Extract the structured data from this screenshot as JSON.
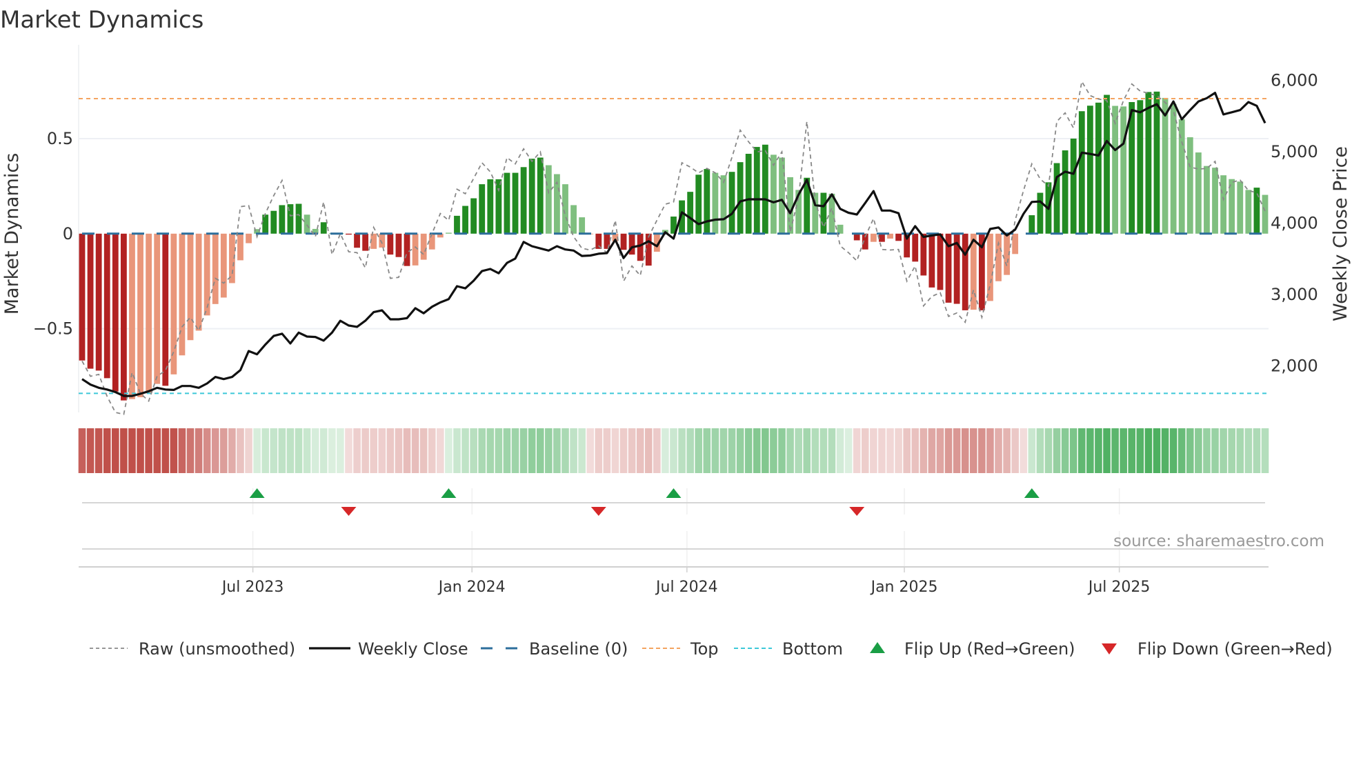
{
  "chart_data": {
    "type": "bar",
    "title": "Market Dynamics",
    "ylabel": "Market Dynamics",
    "y2label": "Weekly Close Price",
    "ylim": [
      -0.94,
      0.935
    ],
    "y2lim": [
      1345,
      6345
    ],
    "y_ticks": [
      {
        "v": 0.5,
        "label": "0.5"
      },
      {
        "v": 0,
        "label": "0"
      },
      {
        "v": -0.5,
        "label": "−0.5"
      }
    ],
    "y2_ticks": [
      {
        "v": 6000,
        "label": "6,000"
      },
      {
        "v": 5000,
        "label": "5,000"
      },
      {
        "v": 4000,
        "label": "4,000"
      },
      {
        "v": 3000,
        "label": "3,000"
      },
      {
        "v": 2000,
        "label": "2,000"
      }
    ],
    "x_unit": "week index",
    "x_ticks": [
      {
        "v": 20.5,
        "label": "Jul 2023"
      },
      {
        "v": 46.8,
        "label": "Jan 2024"
      },
      {
        "v": 72.6,
        "label": "Jul 2024"
      },
      {
        "v": 98.7,
        "label": "Jan 2025"
      },
      {
        "v": 124.5,
        "label": "Jul 2025"
      }
    ],
    "top_level": 0.71,
    "bottom_level": -0.84,
    "baseline": 0,
    "grid": true,
    "legend_position": "bottom",
    "smoothed": [
      -0.667,
      -0.71,
      -0.72,
      -0.76,
      -0.83,
      -0.877,
      -0.87,
      -0.86,
      -0.84,
      -0.79,
      -0.8,
      -0.74,
      -0.64,
      -0.56,
      -0.51,
      -0.43,
      -0.37,
      -0.336,
      -0.26,
      -0.14,
      -0.05,
      0.024,
      0.1,
      0.12,
      0.15,
      0.155,
      0.157,
      0.1,
      0.025,
      0.06,
      0.003,
      0.003,
      -0.005,
      -0.074,
      -0.09,
      -0.08,
      -0.073,
      -0.11,
      -0.123,
      -0.17,
      -0.167,
      -0.137,
      -0.083,
      -0.02,
      0.005,
      0.094,
      0.146,
      0.186,
      0.26,
      0.286,
      0.286,
      0.32,
      0.32,
      0.35,
      0.394,
      0.4,
      0.36,
      0.313,
      0.26,
      0.15,
      0.086,
      -0.003,
      -0.08,
      -0.08,
      -0.04,
      -0.085,
      -0.11,
      -0.143,
      -0.168,
      -0.095,
      0.02,
      0.09,
      0.175,
      0.22,
      0.31,
      0.34,
      0.32,
      0.307,
      0.325,
      0.376,
      0.42,
      0.456,
      0.468,
      0.415,
      0.4,
      0.297,
      0.23,
      0.294,
      0.215,
      0.215,
      0.21,
      0.047,
      0.0,
      -0.035,
      -0.083,
      -0.043,
      -0.043,
      -0.026,
      -0.038,
      -0.125,
      -0.147,
      -0.22,
      -0.283,
      -0.296,
      -0.363,
      -0.369,
      -0.403,
      -0.4,
      -0.403,
      -0.354,
      -0.25,
      -0.217,
      -0.107,
      0.0,
      0.097,
      0.215,
      0.27,
      0.371,
      0.438,
      0.5,
      0.644,
      0.673,
      0.689,
      0.73,
      0.672,
      0.669,
      0.692,
      0.702,
      0.745,
      0.747,
      0.714,
      0.682,
      0.602,
      0.507,
      0.427,
      0.356,
      0.347,
      0.307,
      0.287,
      0.274,
      0.23,
      0.242,
      0.204
    ],
    "raw": [
      -0.67,
      -0.75,
      -0.74,
      -0.855,
      -0.94,
      -0.95,
      -0.73,
      -0.84,
      -0.88,
      -0.75,
      -0.72,
      -0.62,
      -0.49,
      -0.44,
      -0.51,
      -0.39,
      -0.235,
      -0.26,
      -0.22,
      0.142,
      0.148,
      -0.016,
      0.106,
      0.2,
      0.28,
      0.094,
      0.1,
      0.045,
      -0.016,
      0.167,
      -0.11,
      0,
      -0.095,
      -0.1,
      -0.18,
      0.033,
      -0.05,
      -0.235,
      -0.23,
      -0.1,
      -0.07,
      -0.11,
      0,
      0.106,
      0.07,
      0.234,
      0.21,
      0.29,
      0.373,
      0.325,
      0.228,
      0.4,
      0.367,
      0.446,
      0.38,
      0.43,
      0.215,
      0.27,
      0.094,
      -0.016,
      -0.077,
      -0.086,
      -0.064,
      -0.1,
      0.07,
      -0.25,
      -0.17,
      -0.22,
      -0.016,
      0.07,
      0.155,
      0.167,
      0.373,
      0.35,
      0.32,
      0.343,
      0.32,
      0.27,
      0.4,
      0.544,
      0.483,
      0.43,
      0.437,
      0.36,
      0.43,
      0.01,
      0.19,
      0.59,
      0.167,
      0.033,
      0.136,
      -0.064,
      -0.1,
      -0.143,
      -0.016,
      0.08,
      -0.083,
      -0.086,
      -0.083,
      -0.25,
      -0.17,
      -0.38,
      -0.33,
      -0.31,
      -0.435,
      -0.417,
      -0.466,
      -0.296,
      -0.44,
      -0.27,
      -0.05,
      -0.17,
      0.07,
      0.227,
      0.367,
      0.288,
      0.25,
      0.59,
      0.635,
      0.556,
      0.8,
      0.726,
      0.708,
      0.7,
      0.58,
      0.7,
      0.787,
      0.75,
      0.738,
      0.726,
      0.69,
      0.647,
      0.483,
      0.35,
      0.34,
      0.343,
      0.38,
      0.18,
      0.27,
      0.282,
      0.227,
      0.215,
      0.118
    ],
    "weekly_close": [
      1812,
      1736,
      1690,
      1666,
      1630,
      1576,
      1576,
      1606,
      1642,
      1690,
      1666,
      1660,
      1715,
      1715,
      1690,
      1751,
      1842,
      1812,
      1842,
      1939,
      2206,
      2160,
      2297,
      2418,
      2448,
      2312,
      2464,
      2409,
      2403,
      2352,
      2464,
      2630,
      2564,
      2545,
      2630,
      2751,
      2776,
      2651,
      2651,
      2667,
      2806,
      2736,
      2827,
      2888,
      2933,
      3115,
      3085,
      3191,
      3327,
      3357,
      3297,
      3442,
      3503,
      3736,
      3676,
      3645,
      3615,
      3676,
      3630,
      3615,
      3539,
      3545,
      3570,
      3579,
      3767,
      3509,
      3660,
      3685,
      3745,
      3676,
      3872,
      3782,
      4151,
      4070,
      3985,
      4024,
      4048,
      4054,
      4130,
      4303,
      4333,
      4333,
      4333,
      4291,
      4327,
      4139,
      4400,
      4606,
      4251,
      4236,
      4403,
      4200,
      4145,
      4121,
      4282,
      4448,
      4176,
      4176,
      4139,
      3782,
      3957,
      3806,
      3827,
      3842,
      3676,
      3721,
      3557,
      3767,
      3661,
      3918,
      3939,
      3827,
      3909,
      4130,
      4297,
      4303,
      4200,
      4645,
      4721,
      4691,
      4988,
      4970,
      4948,
      5152,
      5024,
      5115,
      5585,
      5554,
      5615,
      5667,
      5509,
      5706,
      5455,
      5585,
      5706,
      5752,
      5827,
      5524,
      5554,
      5585,
      5697,
      5645,
      5403
    ],
    "flip_up": [
      21,
      44,
      71,
      114
    ],
    "flip_down": [
      32,
      62,
      93
    ],
    "legend": [
      {
        "key": "raw",
        "label": "Raw (unsmoothed)"
      },
      {
        "key": "close",
        "label": "Weekly Close"
      },
      {
        "key": "baseline",
        "label": "Baseline (0)"
      },
      {
        "key": "top",
        "label": "Top"
      },
      {
        "key": "bottom",
        "label": "Bottom"
      },
      {
        "key": "up",
        "label": "Flip Up (Red→Green)"
      },
      {
        "key": "down",
        "label": "Flip Down (Green→Red)"
      }
    ],
    "colors": {
      "pos_strong": "#228b22",
      "pos_weak": "#7fbf7f",
      "neg_strong": "#b22222",
      "neg_weak": "#e9967a",
      "raw": "#888888",
      "close": "#111111",
      "baseline": "#2c6e9b",
      "top": "#f4a460",
      "bottom": "#3cc8d8",
      "flip_up": "#1a9e45",
      "flip_down": "#d62728",
      "strip_pos": "#4caf5f",
      "strip_neg": "#c0504a"
    }
  },
  "source": "source: sharemaestro.com"
}
